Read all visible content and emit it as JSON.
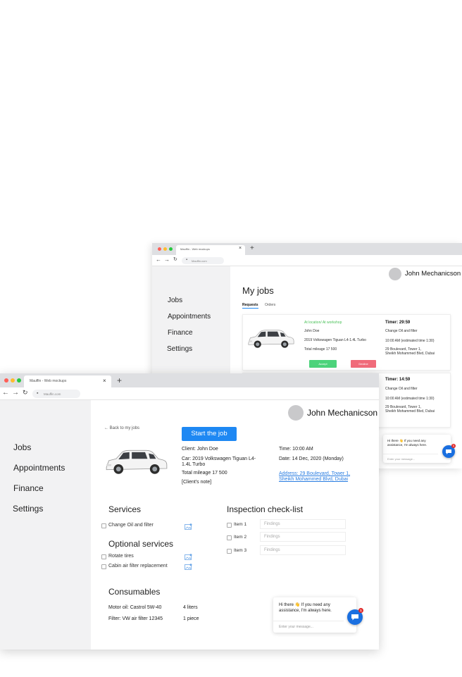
{
  "back_window": {
    "tab_title": "Mauffin - Web mockups",
    "url": "Mauffin.com",
    "user_name": "John Mechanicson",
    "page_title": "My jobs",
    "tabs": [
      "Requests",
      "Orders"
    ],
    "sidebar": [
      "Jobs",
      "Appointments",
      "Finance",
      "Settings"
    ],
    "job_card": {
      "status": "At location/ At workshop",
      "client": "John Doe",
      "car": "2019 Volkswagen Tiguan L4-1.4L Turbo",
      "mileage": "Total mileage  17 500",
      "accept": "Accept",
      "decline": "Decline",
      "timer": "Timer: 29:59",
      "service": "Change Oil and filter",
      "time": "10:00 AM (estimated time 1:30)",
      "address_line1": "29 Boulevard, Tower 1,",
      "address_line2": "Sheikh Mohammed Blvd, Dubai"
    },
    "job_card2": {
      "timer": "Timer: 14:59",
      "service": "Change Oil and filter",
      "time": "10:00 AM (estimated time 1:30)",
      "address_line1": "29 Boulevard, Tower 1,",
      "address_line2": "Sheikh Mohammed Blvd, Dubai"
    },
    "chat": {
      "message": "Hi there 👋 If you need any assistance, I'm always here.",
      "placeholder": "Enter your message...",
      "badge": "1"
    }
  },
  "front_window": {
    "tab_title": "Mauffin - Web mockups",
    "url": "Mauffin.com",
    "user_name": "John Mechanicson",
    "sidebar": [
      "Jobs",
      "Appointments",
      "Finance",
      "Settings"
    ],
    "back_link": "Back to my jobs",
    "start_button": "Start the job",
    "client": "Client: John Doe",
    "car": "Car: 2019 Volkswagen Tiguan L4-1.4L Turbo",
    "mileage": "Total mileage  17 500",
    "note": "[Client's note]",
    "time": "Time: 10:00 AM",
    "date": "Date: 14 Dec, 2020 (Monday)",
    "address": "Address: 29 Boulevard, Tower 1, Sheikh Mohammed Blvd, Dubai",
    "services_title": "Services",
    "services": [
      "Change Oil and filter"
    ],
    "optional_title": "Optional services",
    "optional_services": [
      "Rotate tires",
      "Cabin air filter replacement"
    ],
    "inspection_title": "Inspection check-list",
    "inspection_items": [
      {
        "label": "Item 1",
        "placeholder": "Findings"
      },
      {
        "label": "Item 2",
        "placeholder": "Findings"
      },
      {
        "label": "Item 3",
        "placeholder": "Findings"
      }
    ],
    "consumables_title": "Consumables",
    "consumables": [
      {
        "name": "Motor oil: Castrol 5W-40",
        "qty": "4 liters"
      },
      {
        "name": "Filter: VW air filter 12345",
        "qty": "1 piece"
      }
    ],
    "chat": {
      "message": "Hi there 👋 If you need any assistance, I'm always here.",
      "placeholder": "Enter your message...",
      "badge": "1"
    }
  },
  "colors": {
    "accent": "#1e88f3",
    "accept": "#4cd37b",
    "decline": "#f06b7a",
    "status": "#4cc15a",
    "sidebar_bg": "#f2f2f3"
  }
}
